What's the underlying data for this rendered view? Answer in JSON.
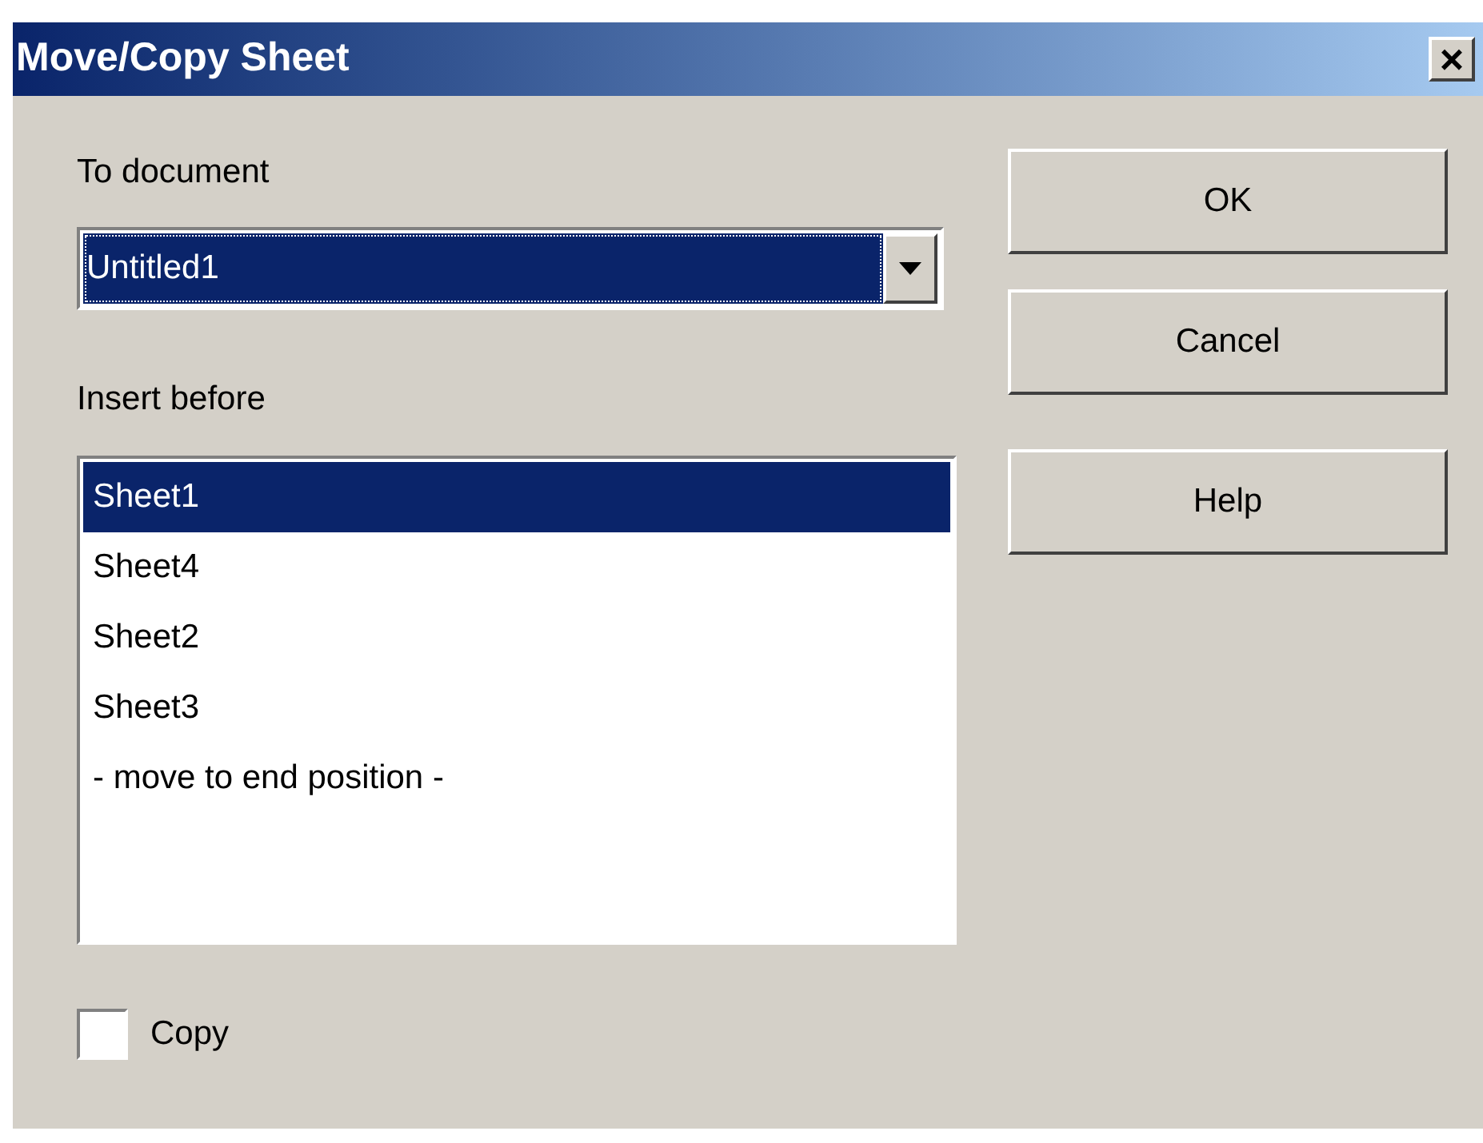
{
  "window": {
    "title": "Move/Copy Sheet",
    "close": "×"
  },
  "document": {
    "label": "To document",
    "value": "Untitled1",
    "focused": true
  },
  "insert_before": {
    "label": "Insert before",
    "items": [
      {
        "label": "Sheet1",
        "selected": true
      },
      {
        "label": "Sheet4",
        "selected": false
      },
      {
        "label": "Sheet2",
        "selected": false
      },
      {
        "label": "Sheet3",
        "selected": false
      },
      {
        "label": "- move to end position -",
        "selected": false
      }
    ]
  },
  "copy": {
    "label": "Copy",
    "checked": false
  },
  "buttons": [
    "OK",
    "Cancel",
    "Help"
  ]
}
